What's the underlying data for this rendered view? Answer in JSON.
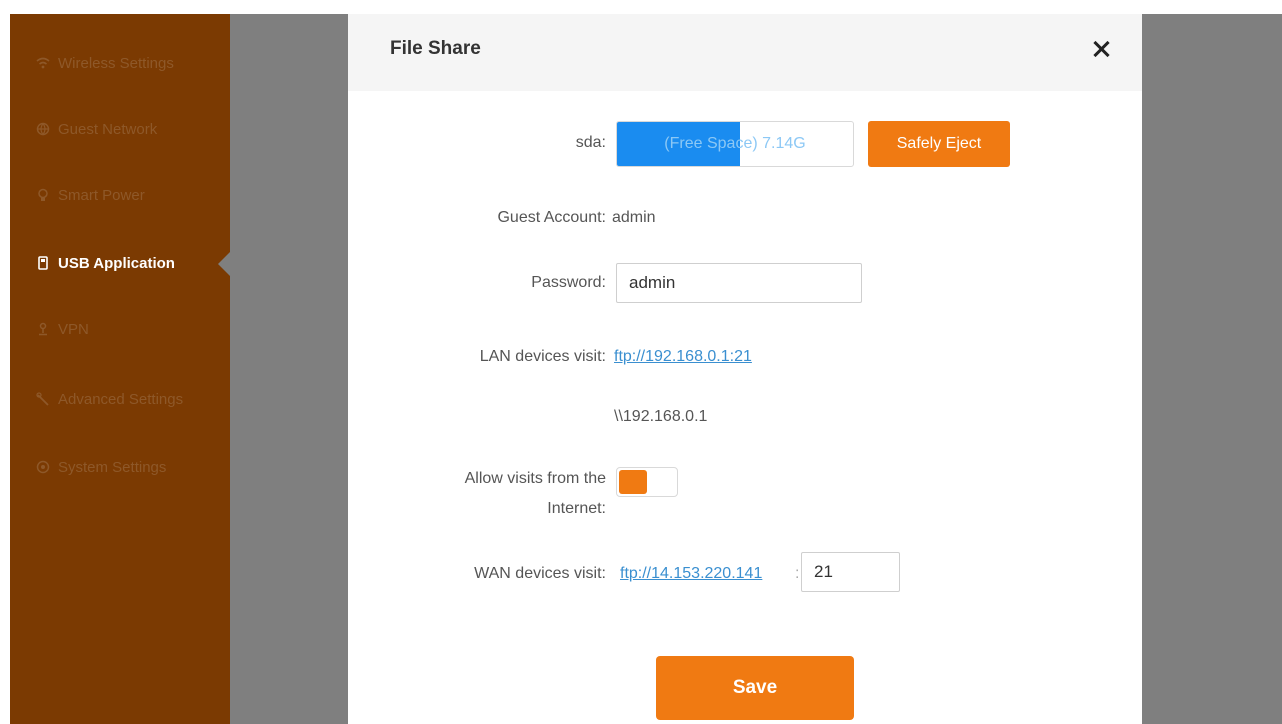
{
  "sidebar": {
    "items": [
      {
        "label": "Wireless Settings",
        "icon": "wifi-icon"
      },
      {
        "label": "Guest Network",
        "icon": "globe-icon"
      },
      {
        "label": "Smart Power",
        "icon": "bulb-icon"
      },
      {
        "label": "USB Application",
        "icon": "usb-icon"
      },
      {
        "label": "VPN",
        "icon": "vpn-icon"
      },
      {
        "label": "Advanced Settings",
        "icon": "tools-icon"
      },
      {
        "label": "System Settings",
        "icon": "gear-icon"
      }
    ],
    "active_index": 3
  },
  "modal": {
    "title": "File Share",
    "close_label": "close"
  },
  "form": {
    "sda_label": "sda:",
    "storage_text": "(Free Space) 7.14G",
    "storage_used_fraction": 0.52,
    "eject_label": "Safely Eject",
    "guest_account_label": "Guest Account:",
    "guest_account_value": "admin",
    "password_label": "Password:",
    "password_value": "admin",
    "lan_label": "LAN devices visit:",
    "lan_ftp": "ftp://192.168.0.1:21",
    "lan_smb": "\\\\192.168.0.1",
    "internet_label_line1": "Allow visits from the",
    "internet_label_line2": "Internet:",
    "internet_toggle_on": true,
    "wan_label": "WAN devices visit:",
    "wan_ftp": "ftp://14.153.220.141",
    "wan_sep": ":",
    "wan_port": "21",
    "save_label": "Save"
  },
  "colors": {
    "accent": "#f07a12",
    "sidebar_bg": "#7b3a02",
    "link": "#3a8fd0",
    "storage_fill": "#1a8cf0"
  }
}
